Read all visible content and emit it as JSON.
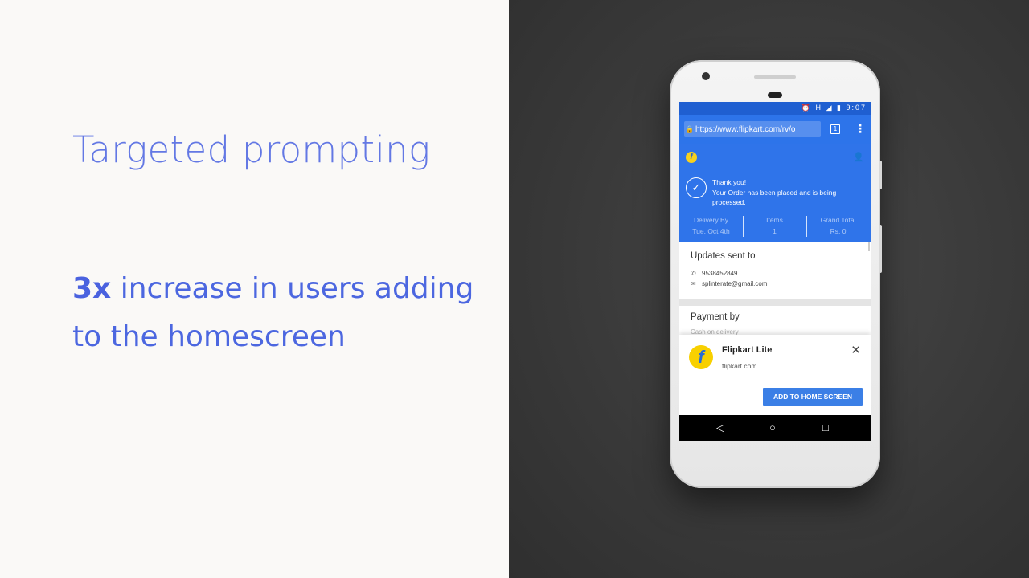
{
  "slide": {
    "title": "Targeted prompting",
    "stat_highlight": "3x",
    "stat_text": "increase in users adding to the homescreen"
  },
  "phone": {
    "status_bar": {
      "time": "9:07",
      "network": "H"
    },
    "browser": {
      "url": "https://www.flipkart.com/rv/o",
      "tab_count": "1"
    },
    "order": {
      "thanks_title": "Thank you!",
      "thanks_message": "Your Order has been placed and is being processed.",
      "delivery_label": "Delivery By",
      "delivery_value": "Tue, Oct 4th",
      "items_label": "Items",
      "items_value": "1",
      "total_label": "Grand Total",
      "total_value": "Rs. 0"
    },
    "updates": {
      "title": "Updates sent to",
      "phone_number": "9538452849",
      "email": "splinterate@gmail.com"
    },
    "payment": {
      "title": "Payment by",
      "method": "Cash on delivery"
    },
    "install_banner": {
      "app_name": "Flipkart Lite",
      "domain": "flipkart.com",
      "button_label": "ADD TO HOME SCREEN"
    },
    "colors": {
      "header_blue": "#2f74ea",
      "accent_blue": "#3b7fe6",
      "logo_yellow": "#f8d000"
    },
    "icons": [
      "lock-icon",
      "tab-switcher-icon",
      "overflow-menu-icon",
      "flipkart-logo-icon",
      "account-icon",
      "check-circle-icon",
      "phone-icon",
      "mail-icon",
      "close-icon",
      "back-icon",
      "home-icon",
      "recents-icon",
      "alarm-icon",
      "signal-icon",
      "battery-icon"
    ]
  }
}
